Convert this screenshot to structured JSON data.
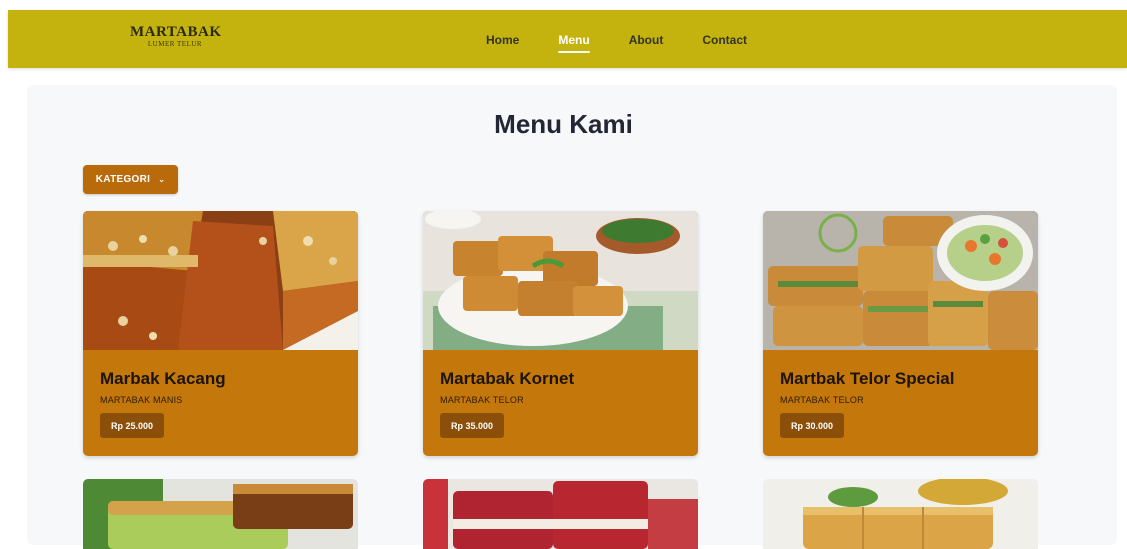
{
  "brand": {
    "name": "MARTABAK",
    "subtitle": "LUMER TELUR"
  },
  "nav": [
    {
      "label": "Home",
      "active": false
    },
    {
      "label": "Menu",
      "active": true
    },
    {
      "label": "About",
      "active": false
    },
    {
      "label": "Contact",
      "active": false
    }
  ],
  "page": {
    "title": "Menu Kami"
  },
  "filter": {
    "label": "KATEGORI",
    "icon": "chevron-down-icon"
  },
  "menu": [
    {
      "name": "Marbak Kacang",
      "category": "MARTABAK MANIS",
      "price": "Rp 25.000"
    },
    {
      "name": "Martabak Kornet",
      "category": "MARTABAK TELOR",
      "price": "Rp 35.000"
    },
    {
      "name": "Martbak Telor Special",
      "category": "MARTABAK TELOR",
      "price": "Rp 30.000"
    }
  ],
  "colors": {
    "navbar": "#c4b30f",
    "accent": "#b96a0a",
    "card": "#c4770a",
    "price_badge": "#8c4f09"
  }
}
